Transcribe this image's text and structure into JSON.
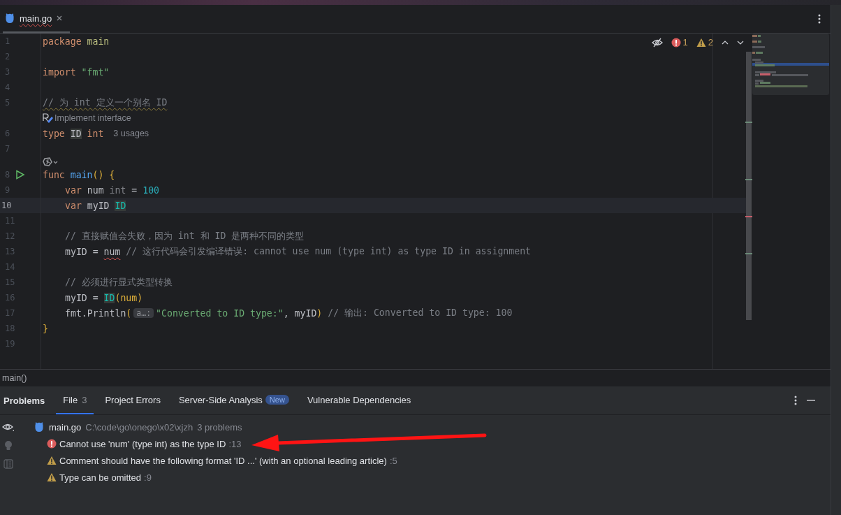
{
  "tabs": [
    {
      "label": "main.go",
      "selected": true,
      "has_errors": true
    }
  ],
  "inspections": {
    "errors": "1",
    "warnings": "2"
  },
  "lines": [
    {
      "number": "1",
      "tokens": [
        {
          "text": "package ",
          "kind": "kw"
        },
        {
          "text": "main",
          "kind": "pkg"
        }
      ]
    },
    {
      "number": "2"
    },
    {
      "number": "3",
      "tokens": [
        {
          "text": "import ",
          "kind": "kw"
        },
        {
          "text": "\"fmt\"",
          "kind": "str"
        }
      ]
    },
    {
      "number": "4"
    },
    {
      "number": "5",
      "tokens": [
        {
          "text": "// 为 int 定义一个别名 ID",
          "kind": "cmt",
          "has_warning": true
        }
      ]
    },
    {
      "kind": "inlay",
      "text": "Implement interface"
    },
    {
      "number": "6",
      "tokens": [
        {
          "text": "type ",
          "kind": "kw"
        },
        {
          "text": "ID",
          "kind": "plain",
          "highlighted": true
        },
        {
          "text": " int",
          "kind": "kw"
        },
        {
          "text": "3 usages",
          "kind": "hint"
        }
      ]
    },
    {
      "number": "7"
    },
    {
      "kind": "inlay-icon"
    },
    {
      "number": "8",
      "run": true,
      "tokens": [
        {
          "text": "func ",
          "kind": "kw"
        },
        {
          "text": "main",
          "kind": "fn"
        },
        {
          "text": "() {",
          "kind": "brace"
        }
      ]
    },
    {
      "number": "9",
      "indented": true,
      "tokens": [
        {
          "text": "var ",
          "kind": "kw"
        },
        {
          "text": "num "
        },
        {
          "text": "int",
          "kind": "weak"
        },
        {
          "text": " = "
        },
        {
          "text": "100",
          "kind": "num"
        }
      ]
    },
    {
      "number": "10",
      "indented": true,
      "current": true,
      "tokens": [
        {
          "text": "var ",
          "kind": "kw"
        },
        {
          "text": "myID "
        },
        {
          "text": "ID",
          "kind": "type",
          "highlighted": true
        }
      ]
    },
    {
      "number": "11"
    },
    {
      "number": "12",
      "indented": true,
      "tokens": [
        {
          "text": "// 直接赋值会失败，因为 int 和 ID 是两种不同的类型",
          "kind": "cmt"
        }
      ]
    },
    {
      "number": "13",
      "indented": true,
      "tokens": [
        {
          "text": "myID = "
        },
        {
          "text": "num",
          "has_error": true
        },
        {
          "text": " // 这行代码会引发编译错误: cannot use num (type int) as type ID in assignment",
          "kind": "cmt"
        }
      ]
    },
    {
      "number": "14"
    },
    {
      "number": "15",
      "indented": true,
      "tokens": [
        {
          "text": "// 必须进行显式类型转换",
          "kind": "cmt"
        }
      ]
    },
    {
      "number": "16",
      "indented": true,
      "tokens": [
        {
          "text": "myID = "
        },
        {
          "text": "ID",
          "kind": "type",
          "highlighted": true
        },
        {
          "text": "(num)",
          "kind": "brace"
        }
      ]
    },
    {
      "number": "17",
      "indented": true,
      "tokens": [
        {
          "text": "fmt.Println"
        },
        {
          "text": "(",
          "kind": "brace"
        },
        {
          "text": "a…:",
          "kind": "param"
        },
        {
          "text": "\"Converted to ID type:\"",
          "kind": "str"
        },
        {
          "text": ", myID"
        },
        {
          "text": ")",
          "kind": "brace"
        },
        {
          "text": " // 输出: Converted to ID type: 100",
          "kind": "cmt"
        }
      ]
    },
    {
      "number": "18",
      "tokens": [
        {
          "text": "}",
          "kind": "brace"
        }
      ]
    },
    {
      "number": "19"
    }
  ],
  "breadcrumb": "main()",
  "problems": {
    "title": "Problems",
    "tabs": [
      {
        "label": "File",
        "count": "3",
        "selected": true
      },
      {
        "label": "Project Errors",
        "selected": false
      },
      {
        "label": "Server-Side Analysis",
        "badge": "New",
        "selected": false
      },
      {
        "label": "Vulnerable Dependencies",
        "selected": false
      }
    ],
    "file": {
      "name": "main.go",
      "path": "C:\\code\\go\\onego\\x02\\xjzh",
      "count": "3 problems",
      "children": [
        {
          "is_error": true,
          "text": "Cannot use 'num' (type int) as the type ID",
          "line": ":13"
        },
        {
          "is_error": false,
          "text": "Comment should have the following format 'ID ...' (with an optional leading article)",
          "line": ":5"
        },
        {
          "is_error": false,
          "text": "Type can be omitted",
          "line": ":9"
        }
      ]
    }
  }
}
